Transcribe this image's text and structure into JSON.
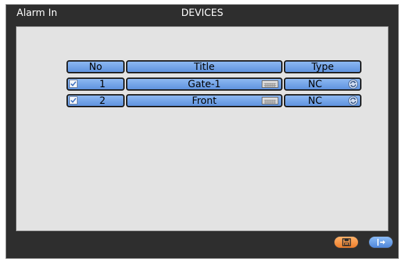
{
  "window": {
    "label": "Alarm In",
    "title": "DEVICES"
  },
  "table": {
    "headers": {
      "no": "No",
      "title": "Title",
      "type": "Type"
    },
    "rows": [
      {
        "checked": true,
        "no": "1",
        "title": "Gate-1",
        "type": "NC"
      },
      {
        "checked": true,
        "no": "2",
        "title": "Front",
        "type": "NC"
      }
    ]
  },
  "icons": {
    "checkbox": "checkbox-icon",
    "keyboard": "keyboard-icon",
    "refresh": "refresh-icon",
    "save": "save-icon",
    "exit": "exit-icon"
  },
  "colors": {
    "cell_blue": "#6f9fe6",
    "save_orange": "#f58a36",
    "exit_blue": "#5b8fde",
    "window_bg": "#2e2e2e",
    "panel_bg": "#e3e3e3"
  }
}
